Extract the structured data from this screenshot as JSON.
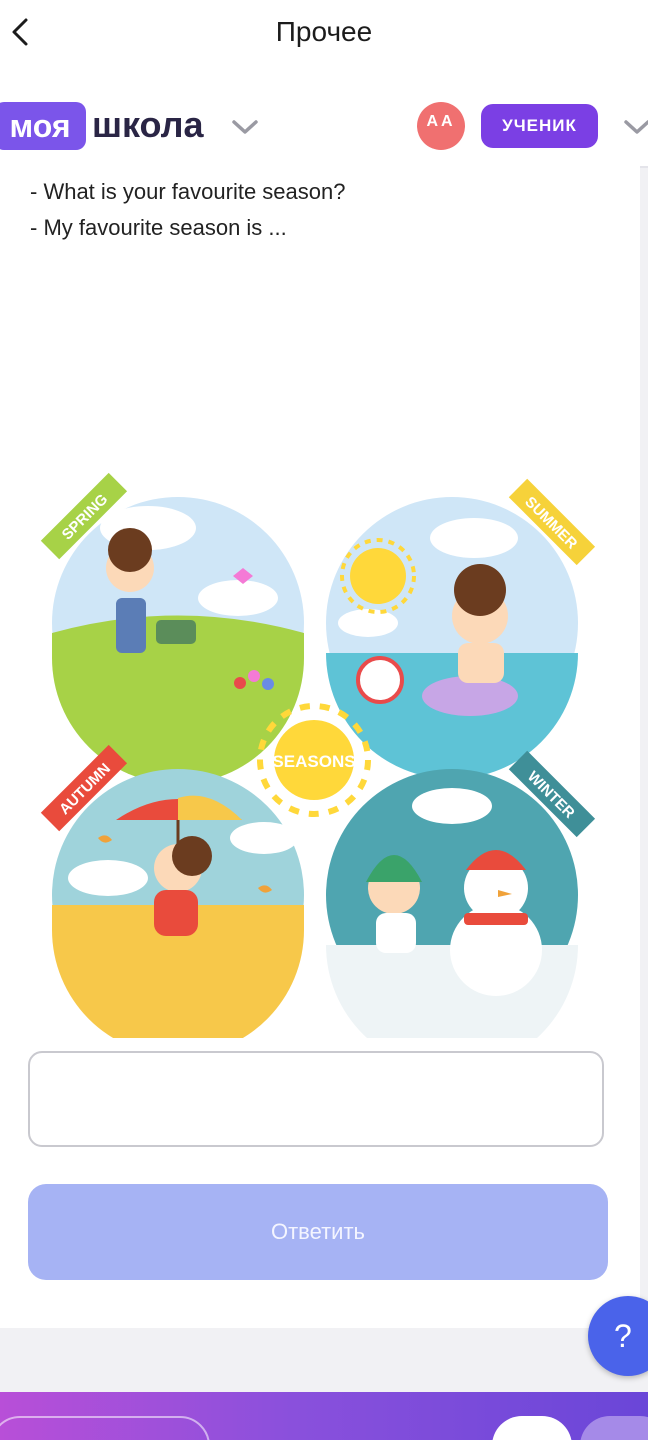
{
  "header": {
    "title": "Прочее"
  },
  "brand": {
    "logo_part1": "моя",
    "logo_part2": "школа",
    "avatar_initials": "АА",
    "role_label": "УЧЕНИК"
  },
  "task": {
    "question_line": "- What is your favourite season?",
    "answer_line": "- My favourite season is ...",
    "illustration": {
      "center_label": "SEASONS",
      "spring_label": "SPRING",
      "summer_label": "SUMMER",
      "autumn_label": "AUTUMN",
      "winter_label": "WINTER"
    },
    "answer_value": "",
    "submit_label": "Ответить"
  },
  "help": {
    "label": "?"
  },
  "colors": {
    "brand_purple": "#7b55ea",
    "role_purple": "#7b3fe4",
    "avatar_red": "#f07070",
    "submit_disabled": "#a6b3f4",
    "help_blue": "#4a63ea"
  },
  "icons": [
    "back-arrow-icon",
    "chevron-down-icon",
    "question-icon"
  ]
}
